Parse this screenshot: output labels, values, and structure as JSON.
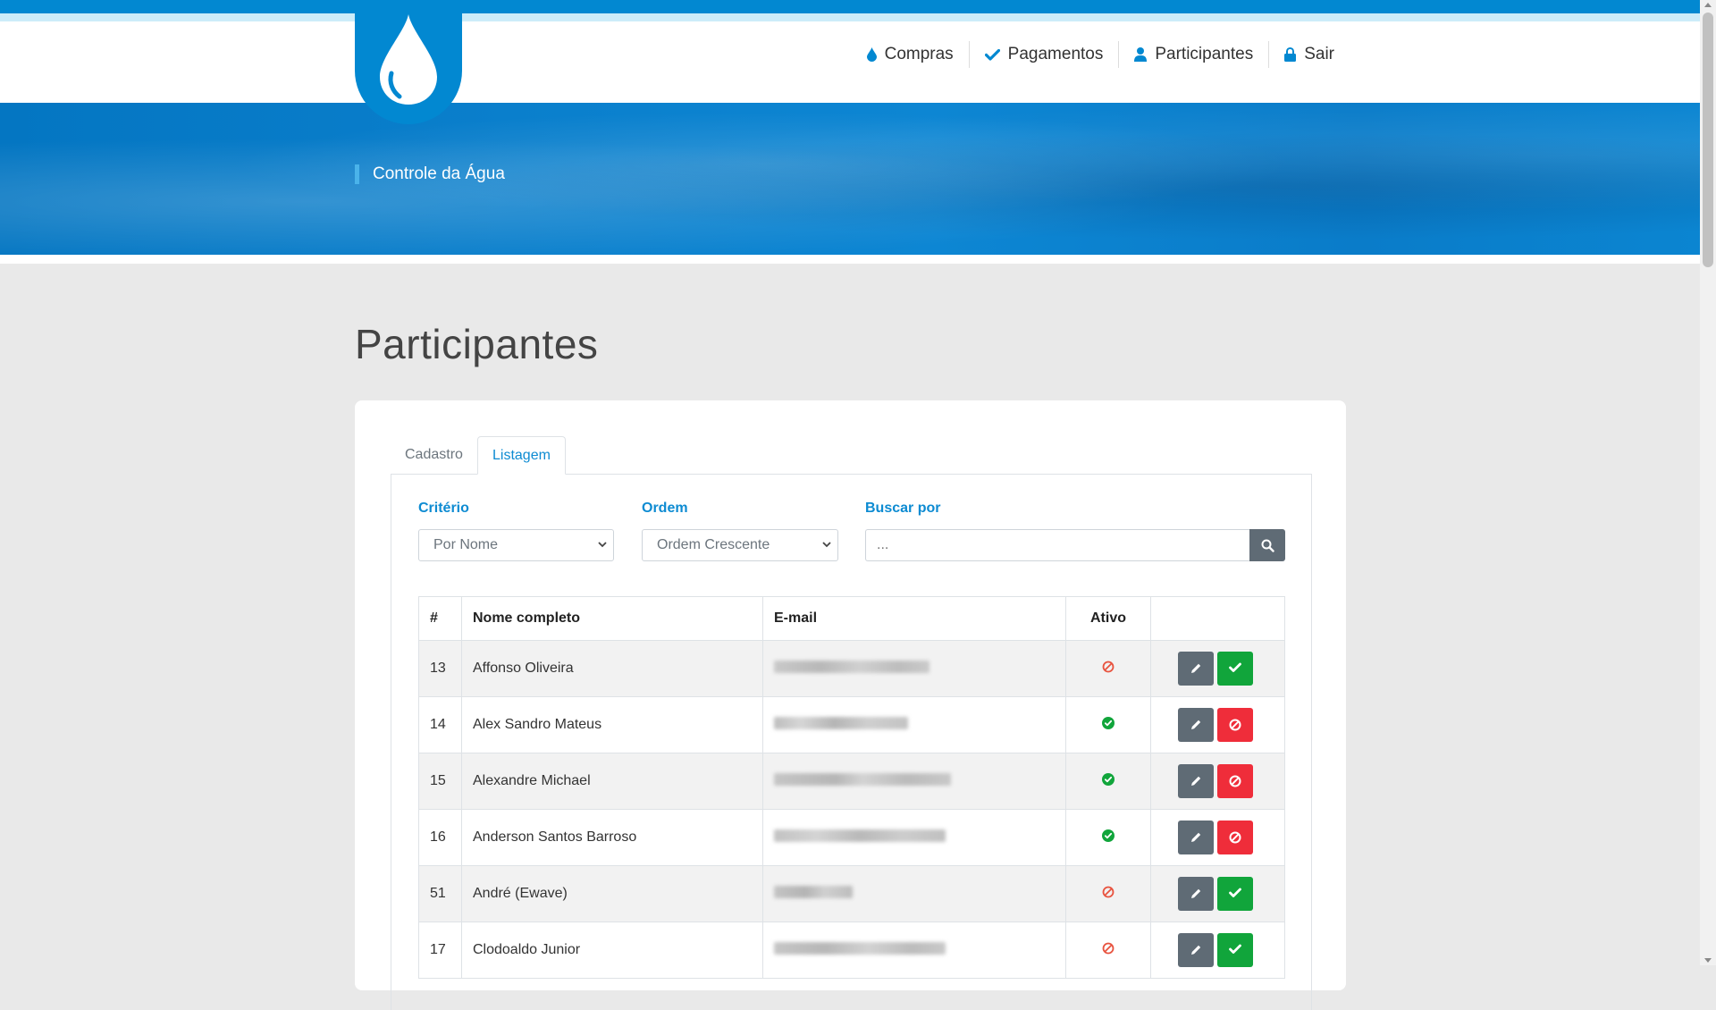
{
  "nav": {
    "items": [
      {
        "label": "Compras",
        "icon": "drop-icon"
      },
      {
        "label": "Pagamentos",
        "icon": "check-icon"
      },
      {
        "label": "Participantes",
        "icon": "user-icon"
      },
      {
        "label": "Sair",
        "icon": "lock-icon"
      }
    ]
  },
  "hero": {
    "title": "Controle da Água"
  },
  "page": {
    "title": "Participantes"
  },
  "tabs": [
    {
      "label": "Cadastro",
      "active": false
    },
    {
      "label": "Listagem",
      "active": true
    }
  ],
  "filters": {
    "criterio": {
      "label": "Critério",
      "value": "Por Nome"
    },
    "ordem": {
      "label": "Ordem",
      "value": "Ordem Crescente"
    },
    "buscar": {
      "label": "Buscar por",
      "placeholder": "..."
    }
  },
  "table": {
    "headers": [
      "#",
      "Nome completo",
      "E-mail",
      "Ativo",
      ""
    ],
    "rows": [
      {
        "id": "13",
        "name": "Affonso Oliveira",
        "ativo": false
      },
      {
        "id": "14",
        "name": "Alex Sandro Mateus",
        "ativo": true
      },
      {
        "id": "15",
        "name": "Alexandre Michael",
        "ativo": true
      },
      {
        "id": "16",
        "name": "Anderson Santos Barroso",
        "ativo": true
      },
      {
        "id": "51",
        "name": "André (Ewave)",
        "ativo": false
      },
      {
        "id": "17",
        "name": "Clodoaldo Junior",
        "ativo": false
      }
    ]
  },
  "colors": {
    "primary": "#0288d1",
    "accent": "#0d8bd2",
    "success": "#11a53b",
    "danger": "#ef2d3a",
    "secondary": "#5f6b75",
    "inactive_icon": "#e8533f"
  }
}
